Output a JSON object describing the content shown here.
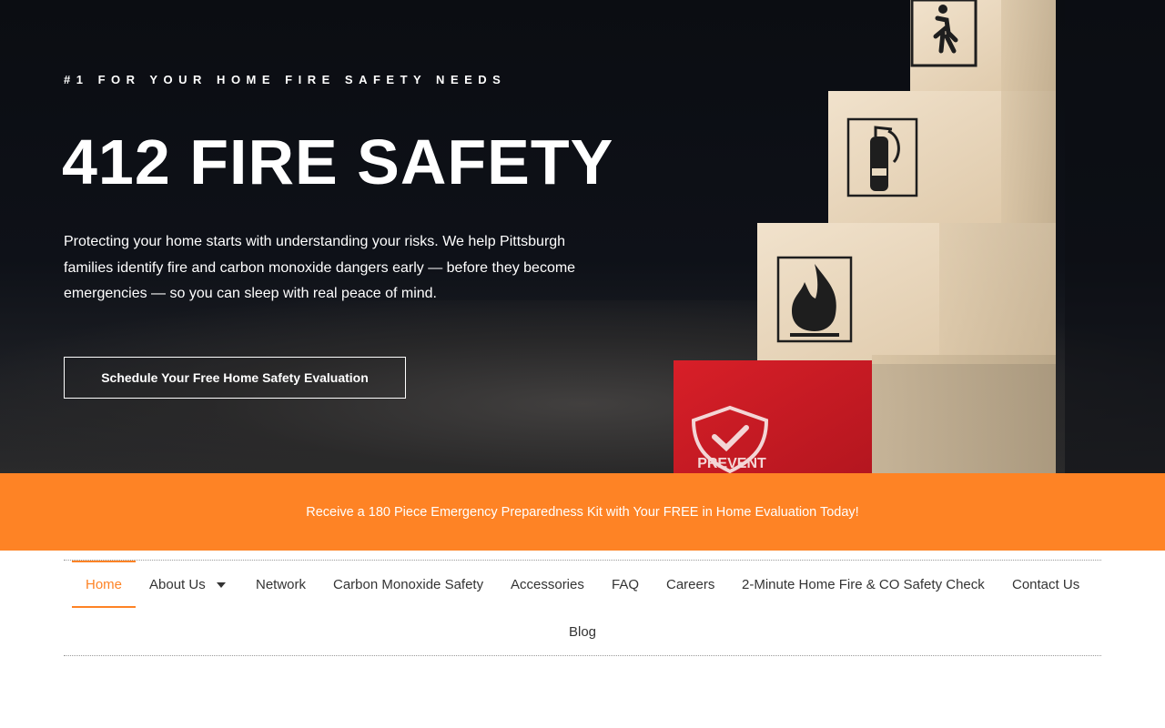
{
  "hero": {
    "eyebrow": "#1 FOR YOUR HOME FIRE SAFETY NEEDS",
    "title": "412 FIRE SAFETY",
    "description": "Protecting your home starts with understanding your risks. We help Pittsburgh families identify fire and carbon monoxide dangers early — before they become emergencies — so you can sleep with real peace of mind.",
    "cta_label": "Schedule Your Free Home Safety Evaluation",
    "block_badge_text": "PREVENT"
  },
  "promo": {
    "text": "Receive a 180 Piece Emergency Preparedness Kit with Your FREE in Home Evaluation Today!"
  },
  "nav": {
    "items": [
      {
        "label": "Home",
        "active": true
      },
      {
        "label": "About Us",
        "has_dropdown": true
      },
      {
        "label": "Network"
      },
      {
        "label": "Carbon Monoxide Safety"
      },
      {
        "label": "Accessories"
      },
      {
        "label": "FAQ"
      },
      {
        "label": "Careers"
      },
      {
        "label": "2-Minute Home Fire & CO Safety Check"
      },
      {
        "label": "Contact Us"
      },
      {
        "label": "Blog"
      }
    ]
  },
  "colors": {
    "accent": "#fe8325",
    "hero_bg": "#0b0d12",
    "block_red": "#d3202a",
    "text_dark": "#333333"
  },
  "icons": [
    "exit-sign-icon",
    "fire-extinguisher-icon",
    "flame-icon",
    "shield-check-icon",
    "chevron-down-icon"
  ]
}
